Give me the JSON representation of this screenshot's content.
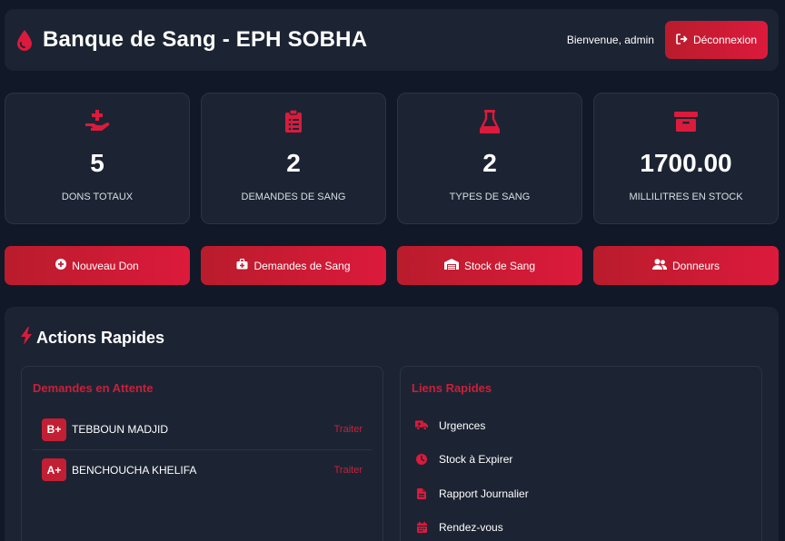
{
  "header": {
    "title": "Banque de Sang - EPH SOBHA",
    "title_icon": "blood-drop-icon",
    "welcome": "Bienvenue, admin",
    "logout_label": "Déconnexion",
    "logout_icon": "sign-out-icon"
  },
  "colors": {
    "accent": "#dc1a3c",
    "accent_dark": "#b91c2c",
    "background": "#111827",
    "card": "#1c2433"
  },
  "stats": [
    {
      "icon": "hand-donate-icon",
      "value": "5",
      "label": "DONS TOTAUX"
    },
    {
      "icon": "clipboard-list-icon",
      "value": "2",
      "label": "DEMANDES DE SANG"
    },
    {
      "icon": "flask-icon",
      "value": "2",
      "label": "TYPES DE SANG"
    },
    {
      "icon": "archive-box-icon",
      "value": "1700.00",
      "label": "MILLILITRES EN STOCK"
    }
  ],
  "actions": [
    {
      "icon": "plus-circle-icon",
      "label": "Nouveau Don"
    },
    {
      "icon": "medkit-icon",
      "label": "Demandes de Sang"
    },
    {
      "icon": "warehouse-icon",
      "label": "Stock de Sang"
    },
    {
      "icon": "users-icon",
      "label": "Donneurs"
    }
  ],
  "quick_actions": {
    "title": "Actions Rapides",
    "icon": "bolt-icon",
    "pending": {
      "title": "Demandes en Attente",
      "items": [
        {
          "blood_type": "B+",
          "name": "TEBBOUN MADJID",
          "action": "Traiter"
        },
        {
          "blood_type": "A+",
          "name": "BENCHOUCHA KHELIFA",
          "action": "Traiter"
        }
      ]
    },
    "links": {
      "title": "Liens Rapides",
      "items": [
        {
          "icon": "ambulance-icon",
          "label": "Urgences"
        },
        {
          "icon": "clock-icon",
          "label": "Stock à Expirer"
        },
        {
          "icon": "file-icon",
          "label": "Rapport Journalier"
        },
        {
          "icon": "calendar-icon",
          "label": "Rendez-vous"
        }
      ]
    }
  }
}
